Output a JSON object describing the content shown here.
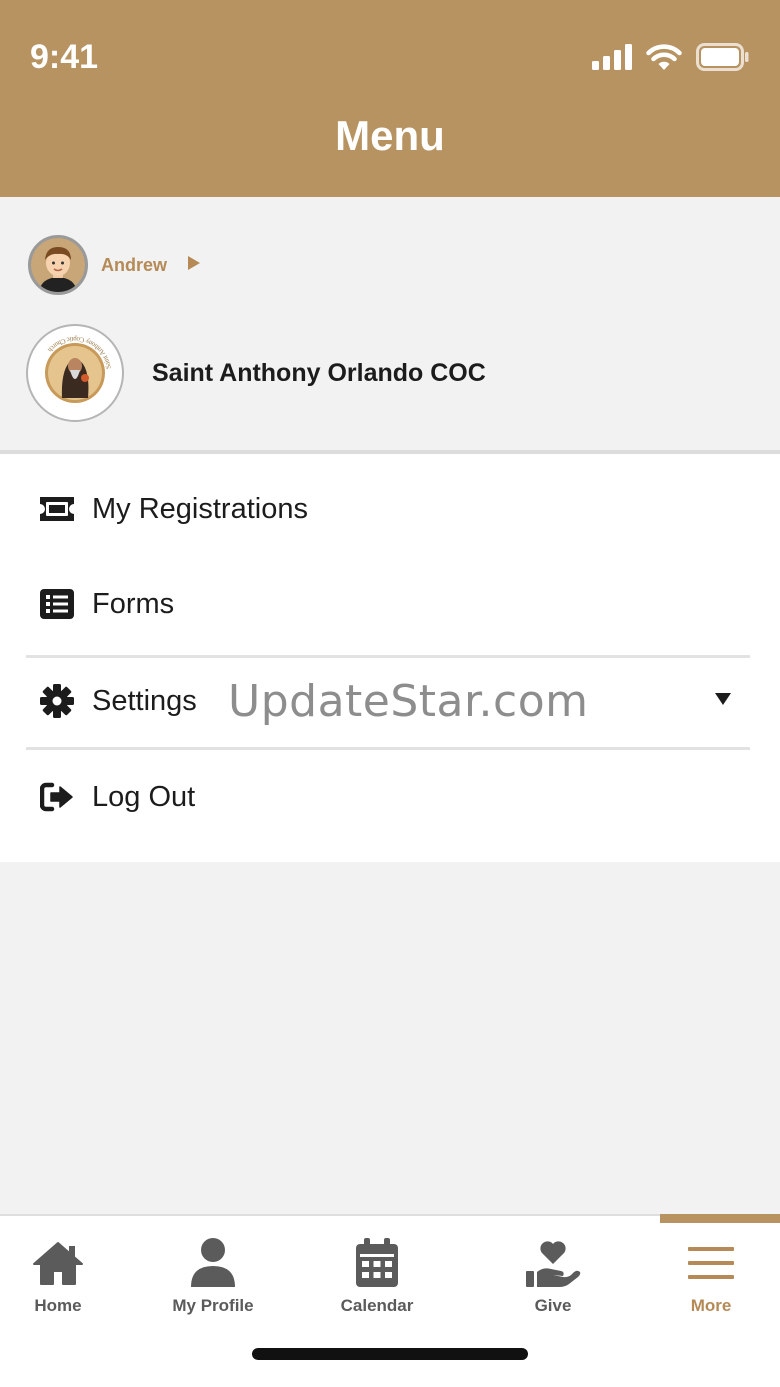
{
  "status_bar": {
    "time": "9:41",
    "signal_icon": "cellular-signal-icon",
    "wifi_icon": "wifi-icon",
    "battery_icon": "battery-icon"
  },
  "header": {
    "title": "Menu",
    "color": "#b79361"
  },
  "profile": {
    "user_name": "Andrew",
    "user_arrow_icon": "play-arrow-icon",
    "church_name": "Saint Anthony Orlando COC",
    "church_logo_text": "Saint Anthony Coptic Church"
  },
  "menu": {
    "items": [
      {
        "label": "My Registrations",
        "icon": "ticket-icon"
      },
      {
        "label": "Forms",
        "icon": "list-icon"
      },
      {
        "label": "Settings",
        "icon": "gear-icon",
        "expand_icon": "caret-down-icon"
      },
      {
        "label": "Log Out",
        "icon": "sign-out-icon"
      }
    ],
    "watermark": "UpdateStar.com"
  },
  "tabbar": {
    "tabs": [
      {
        "label": "Home",
        "icon": "home-icon"
      },
      {
        "label": "My Profile",
        "icon": "user-icon"
      },
      {
        "label": "Calendar",
        "icon": "calendar-icon"
      },
      {
        "label": "Give",
        "icon": "hand-heart-icon"
      },
      {
        "label": "More",
        "icon": "hamburger-menu-icon",
        "active": true
      }
    ],
    "active_color": "#b58a57",
    "inactive_color": "#5b5b5b"
  }
}
